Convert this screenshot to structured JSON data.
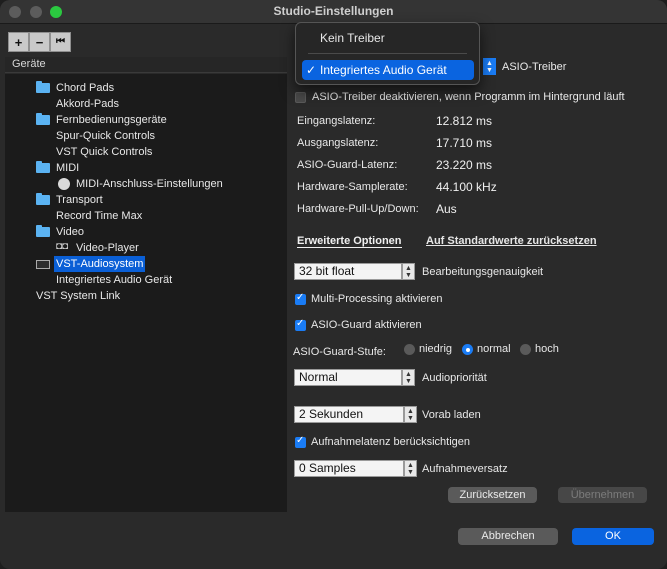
{
  "window": {
    "title": "Studio-Einstellungen"
  },
  "toolbar": {
    "add": "+",
    "remove": "−",
    "reset": "⏮"
  },
  "devices": {
    "header": "Geräte",
    "items": [
      {
        "label": "Chord Pads",
        "icon": "folder-icon"
      },
      {
        "label": "Akkord-Pads"
      },
      {
        "label": "Fernbedienungsgeräte",
        "icon": "folder-icon"
      },
      {
        "label": "Spur-Quick Controls"
      },
      {
        "label": "VST Quick Controls"
      },
      {
        "label": "MIDI",
        "icon": "folder-icon"
      },
      {
        "label": "MIDI-Anschluss-Einstellungen",
        "icon": "midi-icon"
      },
      {
        "label": "Transport",
        "icon": "folder-icon"
      },
      {
        "label": "Record Time Max"
      },
      {
        "label": "Video",
        "icon": "folder-icon"
      },
      {
        "label": "Video-Player",
        "icon": "video-icon"
      },
      {
        "label": "VST-Audiosystem",
        "icon": "audio-device-icon",
        "selected": true
      },
      {
        "label": "Integriertes Audio Gerät"
      },
      {
        "label": "VST System Link"
      }
    ]
  },
  "driver_popup": {
    "items": [
      {
        "label": "Kein Treiber"
      },
      {
        "label": "Integriertes Audio Gerät",
        "checked": true,
        "check": "✓"
      }
    ]
  },
  "settings": {
    "asio_driver_label": "ASIO-Treiber",
    "deactivate_driver": "ASIO-Treiber deaktivieren, wenn Programm im Hintergrund läuft",
    "latency_rows": [
      {
        "label": "Eingangslatenz:",
        "value": "12.812 ms"
      },
      {
        "label": "Ausgangslatenz:",
        "value": "17.710 ms"
      },
      {
        "label": "ASIO-Guard-Latenz:",
        "value": "23.220 ms"
      },
      {
        "label": "Hardware-Samplerate:",
        "value": "44.100 kHz"
      },
      {
        "label": "Hardware-Pull-Up/Down:",
        "value": "Aus"
      }
    ],
    "tab_advanced": "Erweiterte Optionen",
    "reset_defaults_link": "Auf Standardwerte zurücksetzen",
    "precision": {
      "value": "32 bit float",
      "label": "Bearbeitungsgenauigkeit"
    },
    "multi_processing": "Multi-Processing aktivieren",
    "asio_guard": "ASIO-Guard aktivieren",
    "asio_guard_level": {
      "label": "ASIO-Guard-Stufe:",
      "options": [
        "niedrig",
        "normal",
        "hoch"
      ],
      "selected": "normal"
    },
    "audio_priority": {
      "value": "Normal",
      "label": "Audiopriorität"
    },
    "preload": {
      "value": "2 Sekunden",
      "label": "Vorab laden"
    },
    "record_latency": "Aufnahmelatenz berücksichtigen",
    "record_offset": {
      "value": "0 Samples",
      "label": "Aufnahmeversatz"
    },
    "reset_button": "Zurücksetzen",
    "apply_button": "Übernehmen"
  },
  "footer": {
    "cancel": "Abbrechen",
    "ok": "OK"
  },
  "colors": {
    "accent": "#0a64e0",
    "folder": "#5bb3f2",
    "selection": "#0a5fd6"
  }
}
